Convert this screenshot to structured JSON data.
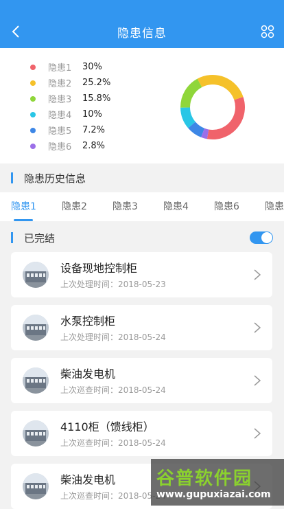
{
  "header": {
    "title": "隐患信息"
  },
  "legend": [
    {
      "name": "隐患1",
      "pct": "30%",
      "value": 30,
      "color": "#f0636b"
    },
    {
      "name": "隐患2",
      "pct": "25.2%",
      "value": 25.2,
      "color": "#f5c12a"
    },
    {
      "name": "隐患3",
      "pct": "15.8%",
      "value": 15.8,
      "color": "#8fd63a"
    },
    {
      "name": "隐患4",
      "pct": "10%",
      "value": 10,
      "color": "#29c6e6"
    },
    {
      "name": "隐患5",
      "pct": "7.2%",
      "value": 7.2,
      "color": "#3d87e6"
    },
    {
      "name": "隐患6",
      "pct": "2.8%",
      "value": 2.8,
      "color": "#9b6fe8"
    }
  ],
  "history": {
    "title": "隐患历史信息"
  },
  "tabs": [
    "隐患1",
    "隐患2",
    "隐患3",
    "隐患4",
    "隐患6",
    "隐患"
  ],
  "completed": {
    "title": "已完结",
    "toggle_on": true
  },
  "items": [
    {
      "name": "设备现地控制柜",
      "sub": "上次处理时间：2018-05-23"
    },
    {
      "name": "水泵控制柜",
      "sub": "上次处理时间：2018-05-24"
    },
    {
      "name": "柴油发电机",
      "sub": "上次巡查时间：2018-05-24"
    },
    {
      "name": "4110柜（馈线柜）",
      "sub": "上次巡查时间：2018-05-24"
    },
    {
      "name": "柴油发电机",
      "sub": "上次巡查时间：2018-05-24"
    }
  ],
  "watermark": {
    "big": "谷普软件园",
    "small": "www.gupuxiazai.com"
  }
}
